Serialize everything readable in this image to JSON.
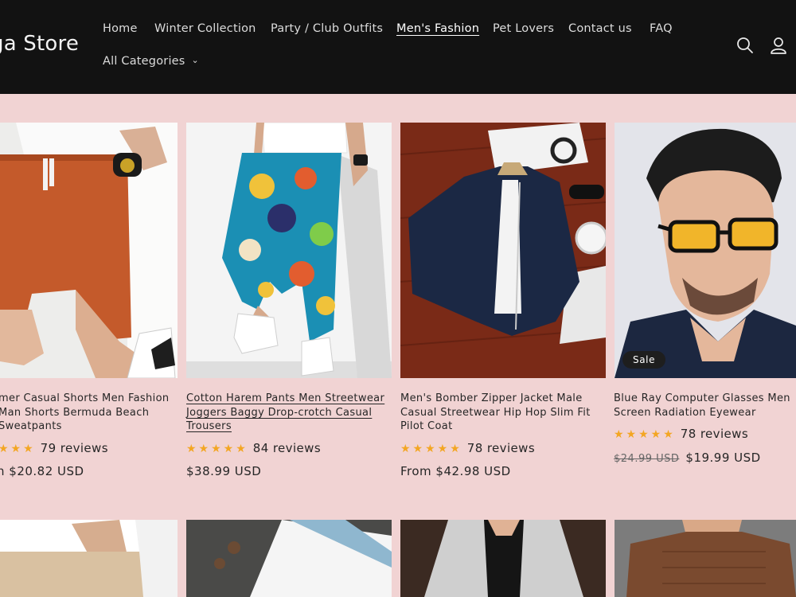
{
  "store": {
    "name": "ga Store"
  },
  "nav": {
    "home": "Home",
    "winter": "Winter Collection",
    "party": "Party / Club Outfits",
    "mens": "Men's Fashion",
    "pets": "Pet Lovers",
    "contact": "Contact us",
    "faq": "FAQ",
    "categories": "All Categories"
  },
  "icons": {
    "search": "search-icon",
    "account": "account-icon",
    "dropdown": "chevron-down-icon"
  },
  "colors": {
    "header_bg": "#121212",
    "page_bg": "#f1d3d3",
    "star": "#f3a623"
  },
  "products": [
    {
      "title": "mer Casual Shorts Men Fashion Man Shorts Bermuda Beach Sweatpants",
      "stars": "★★★",
      "reviews": "79 reviews",
      "price": "n $20.82 USD"
    },
    {
      "title": "Cotton Harem Pants Men Streetwear Joggers Baggy Drop-crotch Casual Trousers",
      "stars": "★★★★★",
      "reviews": "84 reviews",
      "price": "$38.99 USD"
    },
    {
      "title": "Men's Bomber Zipper Jacket Male Casual Streetwear Hip Hop Slim Fit Pilot Coat",
      "stars": "★★★★★",
      "reviews": "78 reviews",
      "price": "From $42.98 USD"
    },
    {
      "title": "Blue Ray Computer Glasses Men Screen Radiation Eyewear",
      "stars": "★★★★★",
      "reviews": "78 reviews",
      "old_price": "$24.99 USD",
      "price": "$19.99 USD",
      "badge": "Sale"
    }
  ]
}
